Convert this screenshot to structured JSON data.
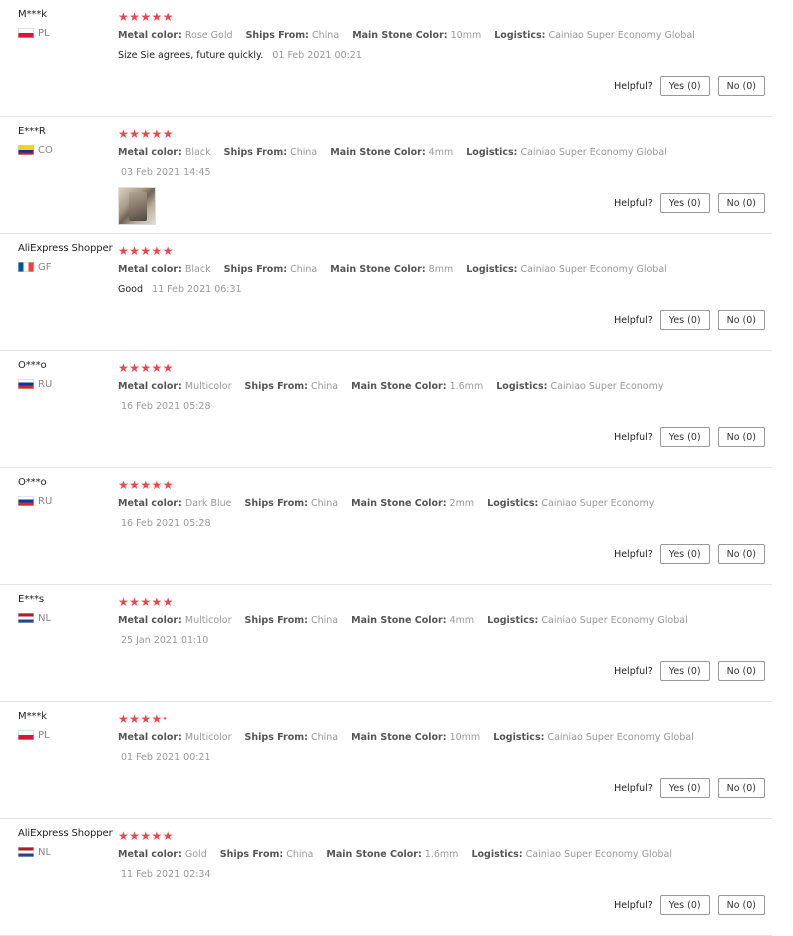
{
  "labels": {
    "metal_color": "Metal color:",
    "ships_from": "Ships From:",
    "main_stone_color": "Main Stone Color:",
    "logistics": "Logistics:",
    "helpful": "Helpful?",
    "yes": "Yes (0)",
    "no": "No (0)"
  },
  "colors": {
    "star": "#f0454b",
    "button_border": "#999999"
  },
  "reviews": [
    {
      "user": "M***k",
      "country": "PL",
      "flag": "pl",
      "stars": 5,
      "metal_color": "Rose Gold",
      "ships_from": "China",
      "main_stone_color": "10mm",
      "logistics": "Cainiao Super Economy Global",
      "comment": "Size Sie agrees, future quickly.",
      "date": "01 Feb 2021 00:21",
      "has_photo": false
    },
    {
      "user": "E***R",
      "country": "CO",
      "flag": "co",
      "stars": 5,
      "metal_color": "Black",
      "ships_from": "China",
      "main_stone_color": "4mm",
      "logistics": "Cainiao Super Economy Global",
      "comment": "",
      "date": "03 Feb 2021 14:45",
      "has_photo": true
    },
    {
      "user": "AliExpress Shopper",
      "country": "GF",
      "flag": "fr",
      "stars": 5,
      "metal_color": "Black",
      "ships_from": "China",
      "main_stone_color": "8mm",
      "logistics": "Cainiao Super Economy Global",
      "comment": "Good",
      "date": "11 Feb 2021 06:31",
      "has_photo": false
    },
    {
      "user": "O***o",
      "country": "RU",
      "flag": "ru",
      "stars": 5,
      "metal_color": "Multicolor",
      "ships_from": "China",
      "main_stone_color": "1.6mm",
      "logistics": "Cainiao Super Economy",
      "comment": "",
      "date": "16 Feb 2021 05:28",
      "has_photo": false
    },
    {
      "user": "O***o",
      "country": "RU",
      "flag": "ru",
      "stars": 5,
      "metal_color": "Dark Blue",
      "ships_from": "China",
      "main_stone_color": "2mm",
      "logistics": "Cainiao Super Economy",
      "comment": "",
      "date": "16 Feb 2021 05:28",
      "has_photo": false
    },
    {
      "user": "E***s",
      "country": "NL",
      "flag": "nl",
      "stars": 5,
      "metal_color": "Multicolor",
      "ships_from": "China",
      "main_stone_color": "4mm",
      "logistics": "Cainiao Super Economy Global",
      "comment": "",
      "date": "25 Jan 2021 01:10",
      "has_photo": false
    },
    {
      "user": "M***k",
      "country": "PL",
      "flag": "pl",
      "stars": 4.5,
      "metal_color": "Multicolor",
      "ships_from": "China",
      "main_stone_color": "10mm",
      "logistics": "Cainiao Super Economy Global",
      "comment": "",
      "date": "01 Feb 2021 00:21",
      "has_photo": false
    },
    {
      "user": "AliExpress Shopper",
      "country": "NL",
      "flag": "nl",
      "stars": 5,
      "metal_color": "Gold",
      "ships_from": "China",
      "main_stone_color": "1.6mm",
      "logistics": "Cainiao Super Economy Global",
      "comment": "",
      "date": "11 Feb 2021 02:34",
      "has_photo": false
    }
  ]
}
